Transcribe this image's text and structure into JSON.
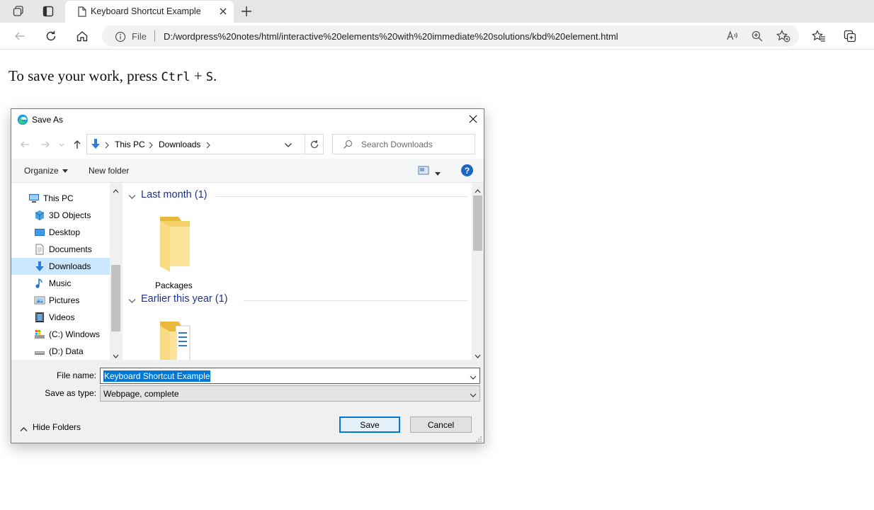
{
  "browser": {
    "tab_title": "Keyboard Shortcut Example",
    "address_scheme": "File",
    "address_url": "D:/wordpress%20notes/html/interactive%20elements%20with%20immediate%20solutions/kbd%20element.html"
  },
  "page": {
    "text_before": "To save your work, press ",
    "key1": "Ctrl",
    "plus": " + ",
    "key2": "S",
    "text_after": "."
  },
  "dialog": {
    "title": "Save As",
    "path": [
      "This PC",
      "Downloads"
    ],
    "search_placeholder": "Search Downloads",
    "organize_label": "Organize",
    "new_folder_label": "New folder",
    "help_label": "?",
    "nav_items": [
      {
        "label": "This PC",
        "icon": "computer-icon"
      },
      {
        "label": "3D Objects",
        "icon": "cube-icon"
      },
      {
        "label": "Desktop",
        "icon": "desktop-icon"
      },
      {
        "label": "Documents",
        "icon": "document-icon"
      },
      {
        "label": "Downloads",
        "icon": "download-arrow-icon"
      },
      {
        "label": "Music",
        "icon": "music-note-icon"
      },
      {
        "label": "Pictures",
        "icon": "pictures-icon"
      },
      {
        "label": "Videos",
        "icon": "film-icon"
      },
      {
        "label": "(C:) Windows",
        "icon": "drive-icon"
      },
      {
        "label": "(D:) Data",
        "icon": "drive-icon"
      }
    ],
    "groups": [
      {
        "heading": "Last month (1)",
        "items": [
          {
            "label": "Packages"
          }
        ]
      },
      {
        "heading": "Earlier this year (1)",
        "items": [
          {
            "label": ""
          }
        ]
      }
    ],
    "file_name_label": "File name:",
    "file_name_value": "Keyboard Shortcut Example",
    "save_type_label": "Save as type:",
    "save_type_value": "Webpage, complete",
    "hide_folders_label": "Hide Folders",
    "save_label": "Save",
    "cancel_label": "Cancel"
  },
  "colors": {
    "accent": "#0078d7",
    "selection": "#cce8ff",
    "group_heading": "#1e3287",
    "folder": "#f8d775"
  }
}
